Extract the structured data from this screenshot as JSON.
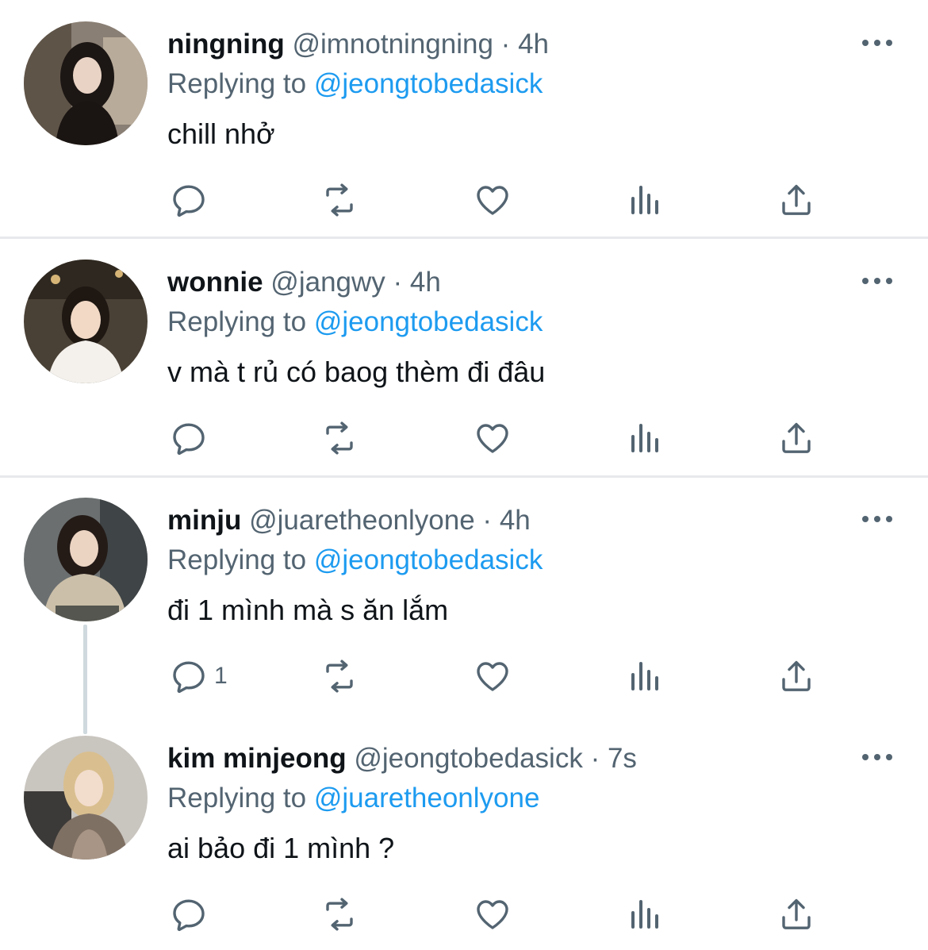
{
  "tweets": [
    {
      "name": "ningning",
      "handle": "@imnotningning",
      "dot": "·",
      "time": "4h",
      "reply_prefix": "Replying to ",
      "reply_to": "@jeongtobedasick",
      "text": "chill nhở",
      "reply_count": ""
    },
    {
      "name": "wonnie",
      "handle": "@jangwy",
      "dot": "·",
      "time": "4h",
      "reply_prefix": "Replying to ",
      "reply_to": "@jeongtobedasick",
      "text": "v mà t rủ có baog thèm đi đâu",
      "reply_count": ""
    },
    {
      "name": "minju",
      "handle": "@juaretheonlyone",
      "dot": "·",
      "time": "4h",
      "reply_prefix": "Replying to ",
      "reply_to": "@jeongtobedasick",
      "text": "đi 1 mình mà s ăn lắm",
      "reply_count": "1"
    },
    {
      "name": "kim minjeong",
      "handle": "@jeongtobedasick",
      "dot": "·",
      "time": "7s",
      "reply_prefix": "Replying to ",
      "reply_to": "@juaretheonlyone",
      "text": "ai bảo đi 1 mình ?",
      "reply_count": ""
    }
  ],
  "icons": {
    "reply": "reply-icon",
    "retweet": "retweet-icon",
    "like": "like-icon",
    "views": "views-icon",
    "share": "share-icon",
    "more": "more-icon"
  },
  "colors": {
    "text": "#0f1419",
    "secondary": "#536471",
    "accent": "#1d9bf0",
    "separator": "#e7e9ec",
    "thread_line": "#cfd9de"
  }
}
